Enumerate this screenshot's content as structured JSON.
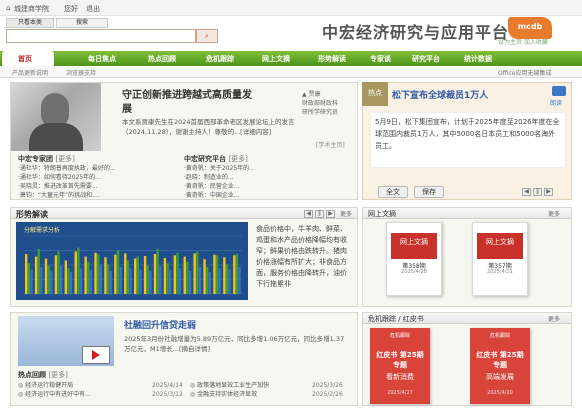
{
  "topbar": {
    "site": "城建商学院",
    "user": "您好",
    "logout": "退出"
  },
  "search": {
    "tab1": "只看本类",
    "tab2": "搜索",
    "placeholder": ""
  },
  "header": {
    "title": "中宏经济研究与应用平台",
    "logo": "mcdb",
    "sublinks": "设为主页 加入收藏"
  },
  "nav": [
    "首页",
    "每日焦点",
    "热点回顾",
    "危机跟踪",
    "网上文摘",
    "形势解读",
    "专家谈",
    "研究平台",
    "统计数据"
  ],
  "subnav": {
    "left1": "产品更新说明",
    "left2": "浏览器支持",
    "right": "Office应用无缝集成"
  },
  "feature": {
    "title1": "守正创新推进跨越式高质量发",
    "title2": "展",
    "side": [
      "▲ 贾康",
      "财政部财政科",
      "研所学研究员"
    ],
    "body": "本文系贾康先生在2024首届西部革命老区发展论坛上的发言（2024.11.28），谢谢主持人！尊敬的...[详细内容]",
    "tag": "[学术主页]"
  },
  "lists": {
    "expert_title": "中宏专家团",
    "more": "[更多]",
    "expert_items": [
      "·通社华：特朗普再度执政，最好的...",
      "·通社华：如何看待2025年的...",
      "·吴晓灵：推进改革首先需要...",
      "·萧钧：“大童元年”的挑战和...."
    ],
    "platform_title": "中宏研究平台",
    "platform_items": [
      "·黄奇帆：关于2025年的...",
      "·赵晓：制造业的...",
      "·黄奇帆：民营企业...",
      "·黄奇帆：中国企业..."
    ]
  },
  "news": {
    "tag": "热点",
    "title": "松下宣布全球裁员1万人",
    "audio": "朗读",
    "body": "5月9日，松下集团宣布，计划于2025年度至2026年度在全球范围内裁员1万人，其中5000名日本员工和5000名海外员工。",
    "btn_all": "全文",
    "btn_save": "保存"
  },
  "trend": {
    "title": "形势解读",
    "more": "更多",
    "chart_title": "分解需求分析",
    "text": "食品价格中，牛羊肉、鲜菜、鸡蛋和水产品价格降幅均有收窄；鲜果价格由跌转升。猪肉价格涨幅有所扩大；非食品方面，服务价格由降转升，油价下行拖累非"
  },
  "digest": {
    "title": "网上文摘",
    "more": "更多",
    "books": [
      {
        "name": "网上文摘",
        "issue": "第358期",
        "date": "2025/4/28"
      },
      {
        "name": "网上文摘",
        "issue": "第357期",
        "date": "2025/4/21"
      }
    ]
  },
  "chart_data": {
    "type": "bar",
    "title": "分解需求分析",
    "categories": [
      "1",
      "2",
      "3",
      "4",
      "5",
      "6",
      "7",
      "8",
      "9",
      "10",
      "11",
      "12",
      "13",
      "14",
      "15",
      "16",
      "17",
      "18",
      "19",
      "20",
      "21",
      "22"
    ],
    "series": [
      {
        "name": "",
        "values": [
          62,
          58,
          55,
          60,
          52,
          66,
          58,
          64,
          57,
          61,
          63,
          55,
          59,
          62,
          56,
          60,
          58,
          63,
          54,
          61,
          57,
          60
        ],
        "color": "#f3c418"
      },
      {
        "name": "",
        "values": [
          48,
          70,
          44,
          66,
          40,
          72,
          50,
          62,
          46,
          68,
          52,
          58,
          44,
          70,
          48,
          64,
          50,
          66,
          42,
          60,
          46,
          62
        ],
        "color": "#3a9f3a"
      },
      {
        "name": "",
        "values": [
          38,
          42,
          36,
          44,
          34,
          40,
          38,
          46,
          36,
          42,
          40,
          38,
          36,
          44,
          38,
          40,
          36,
          42,
          34,
          40,
          38,
          42
        ],
        "color": "#3b6fc9"
      }
    ],
    "ylim": [
      0,
      90
    ]
  },
  "credit": {
    "title": "社融回升信贷走弱",
    "body": "2025年3月份社融增量为5.89万亿元，同比多增1.06万亿元，同比多增1.37万亿元，M1增长...[摘自详情]"
  },
  "hot": {
    "title": "热点回顾",
    "more": "[更多]",
    "items": [
      {
        "text": "◎ 经济运行稳健开局",
        "date": "2025/4/14"
      },
      {
        "text": "◎ 政策落地显效工业生产加快",
        "date": "2025/3/26"
      },
      {
        "text": "◎ 经济运行中有进好中有...",
        "date": "2025/3/12"
      },
      {
        "text": "◎ 金融支持实体经济显效",
        "date": "2025/2/26"
      }
    ]
  },
  "crisis": {
    "title": "危机跟踪 / 红皮书",
    "more": "更多",
    "books": [
      {
        "badge": "危机跟踪",
        "title": "红皮书 第25期 专题",
        "sub": "看新消费",
        "date": "2025/4/27"
      },
      {
        "badge": "危机跟踪",
        "title": "红皮书 第25期 专题",
        "sub": "高端发展",
        "date": "2025/4/20"
      }
    ]
  }
}
